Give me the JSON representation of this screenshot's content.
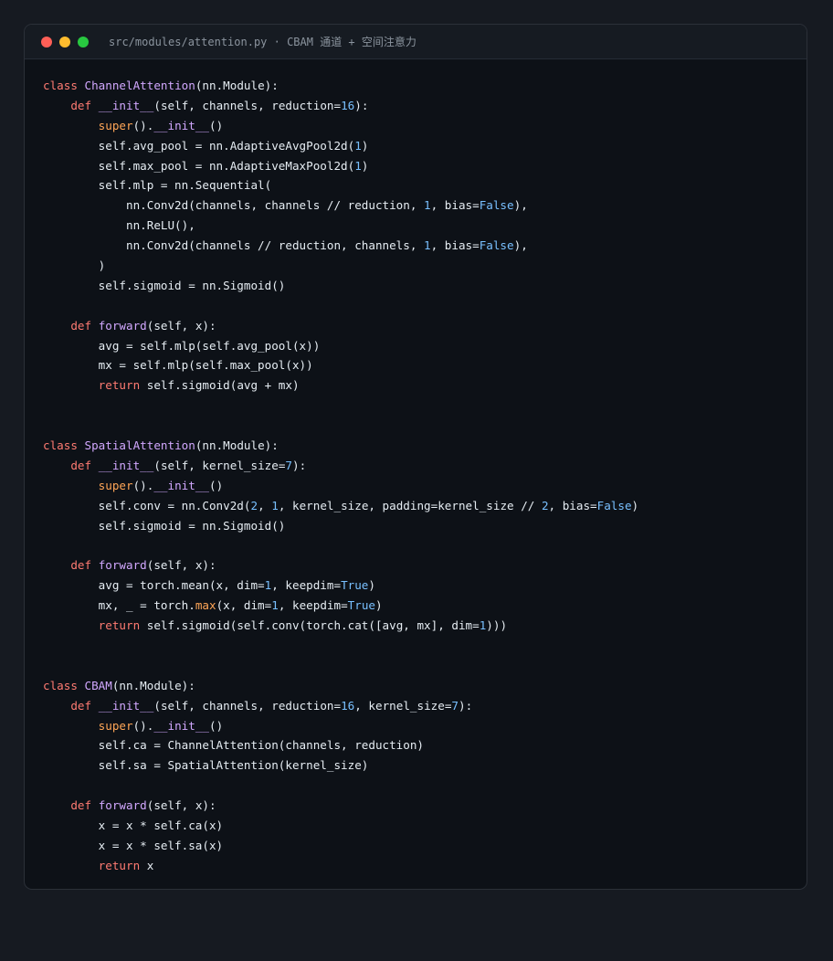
{
  "window": {
    "title": "src/modules/attention.py · CBAM 通道 + 空间注意力"
  },
  "colors": {
    "keyword": "#ff7b72",
    "class_name": "#d2a8ff",
    "function": "#d2a8ff",
    "number": "#79c0ff",
    "builtin": "#ffa657",
    "text": "#e6edf3",
    "background": "#0d1117"
  },
  "code": {
    "language": "python",
    "lines": [
      [
        [
          "kw",
          "class "
        ],
        [
          "cls",
          "ChannelAttention"
        ],
        [
          "plain",
          "(nn.Module):"
        ]
      ],
      [
        [
          "plain",
          "    "
        ],
        [
          "kw",
          "def "
        ],
        [
          "fn",
          "__init__"
        ],
        [
          "plain",
          "(self, channels, reduction="
        ],
        [
          "num",
          "16"
        ],
        [
          "plain",
          "):"
        ]
      ],
      [
        [
          "plain",
          "        "
        ],
        [
          "builtin",
          "super"
        ],
        [
          "plain",
          "()."
        ],
        [
          "fn",
          "__init__"
        ],
        [
          "plain",
          "()"
        ]
      ],
      [
        [
          "plain",
          "        self.avg_pool = nn.AdaptiveAvgPool2d("
        ],
        [
          "num",
          "1"
        ],
        [
          "plain",
          ")"
        ]
      ],
      [
        [
          "plain",
          "        self.max_pool = nn.AdaptiveMaxPool2d("
        ],
        [
          "num",
          "1"
        ],
        [
          "plain",
          ")"
        ]
      ],
      [
        [
          "plain",
          "        self.mlp = nn.Sequential("
        ]
      ],
      [
        [
          "plain",
          "            nn.Conv2d(channels, channels // reduction, "
        ],
        [
          "num",
          "1"
        ],
        [
          "plain",
          ", bias="
        ],
        [
          "const",
          "False"
        ],
        [
          "plain",
          "),"
        ]
      ],
      [
        [
          "plain",
          "            nn.ReLU(),"
        ]
      ],
      [
        [
          "plain",
          "            nn.Conv2d(channels // reduction, channels, "
        ],
        [
          "num",
          "1"
        ],
        [
          "plain",
          ", bias="
        ],
        [
          "const",
          "False"
        ],
        [
          "plain",
          "),"
        ]
      ],
      [
        [
          "plain",
          "        )"
        ]
      ],
      [
        [
          "plain",
          "        self.sigmoid = nn.Sigmoid()"
        ]
      ],
      [],
      [
        [
          "plain",
          "    "
        ],
        [
          "kw",
          "def "
        ],
        [
          "fn",
          "forward"
        ],
        [
          "plain",
          "(self, x):"
        ]
      ],
      [
        [
          "plain",
          "        avg = self.mlp(self.avg_pool(x))"
        ]
      ],
      [
        [
          "plain",
          "        mx = self.mlp(self.max_pool(x))"
        ]
      ],
      [
        [
          "plain",
          "        "
        ],
        [
          "kw",
          "return "
        ],
        [
          "plain",
          "self.sigmoid(avg + mx)"
        ]
      ],
      [],
      [],
      [
        [
          "kw",
          "class "
        ],
        [
          "cls",
          "SpatialAttention"
        ],
        [
          "plain",
          "(nn.Module):"
        ]
      ],
      [
        [
          "plain",
          "    "
        ],
        [
          "kw",
          "def "
        ],
        [
          "fn",
          "__init__"
        ],
        [
          "plain",
          "(self, kernel_size="
        ],
        [
          "num",
          "7"
        ],
        [
          "plain",
          "):"
        ]
      ],
      [
        [
          "plain",
          "        "
        ],
        [
          "builtin",
          "super"
        ],
        [
          "plain",
          "()."
        ],
        [
          "fn",
          "__init__"
        ],
        [
          "plain",
          "()"
        ]
      ],
      [
        [
          "plain",
          "        self.conv = nn.Conv2d("
        ],
        [
          "num",
          "2"
        ],
        [
          "plain",
          ", "
        ],
        [
          "num",
          "1"
        ],
        [
          "plain",
          ", kernel_size, padding=kernel_size // "
        ],
        [
          "num",
          "2"
        ],
        [
          "plain",
          ", bias="
        ],
        [
          "const",
          "False"
        ],
        [
          "plain",
          ")"
        ]
      ],
      [
        [
          "plain",
          "        self.sigmoid = nn.Sigmoid()"
        ]
      ],
      [],
      [
        [
          "plain",
          "    "
        ],
        [
          "kw",
          "def "
        ],
        [
          "fn",
          "forward"
        ],
        [
          "plain",
          "(self, x):"
        ]
      ],
      [
        [
          "plain",
          "        avg = torch.mean(x, dim="
        ],
        [
          "num",
          "1"
        ],
        [
          "plain",
          ", keepdim="
        ],
        [
          "const",
          "True"
        ],
        [
          "plain",
          ")"
        ]
      ],
      [
        [
          "plain",
          "        mx, _ = torch."
        ],
        [
          "builtin",
          "max"
        ],
        [
          "plain",
          "(x, dim="
        ],
        [
          "num",
          "1"
        ],
        [
          "plain",
          ", keepdim="
        ],
        [
          "const",
          "True"
        ],
        [
          "plain",
          ")"
        ]
      ],
      [
        [
          "plain",
          "        "
        ],
        [
          "kw",
          "return "
        ],
        [
          "plain",
          "self.sigmoid(self.conv(torch.cat([avg, mx], dim="
        ],
        [
          "num",
          "1"
        ],
        [
          "plain",
          ")))"
        ]
      ],
      [],
      [],
      [
        [
          "kw",
          "class "
        ],
        [
          "cls",
          "CBAM"
        ],
        [
          "plain",
          "(nn.Module):"
        ]
      ],
      [
        [
          "plain",
          "    "
        ],
        [
          "kw",
          "def "
        ],
        [
          "fn",
          "__init__"
        ],
        [
          "plain",
          "(self, channels, reduction="
        ],
        [
          "num",
          "16"
        ],
        [
          "plain",
          ", kernel_size="
        ],
        [
          "num",
          "7"
        ],
        [
          "plain",
          "):"
        ]
      ],
      [
        [
          "plain",
          "        "
        ],
        [
          "builtin",
          "super"
        ],
        [
          "plain",
          "()."
        ],
        [
          "fn",
          "__init__"
        ],
        [
          "plain",
          "()"
        ]
      ],
      [
        [
          "plain",
          "        self.ca = ChannelAttention(channels, reduction)"
        ]
      ],
      [
        [
          "plain",
          "        self.sa = SpatialAttention(kernel_size)"
        ]
      ],
      [],
      [
        [
          "plain",
          "    "
        ],
        [
          "kw",
          "def "
        ],
        [
          "fn",
          "forward"
        ],
        [
          "plain",
          "(self, x):"
        ]
      ],
      [
        [
          "plain",
          "        x = x * self.ca(x)"
        ]
      ],
      [
        [
          "plain",
          "        x = x * self.sa(x)"
        ]
      ],
      [
        [
          "plain",
          "        "
        ],
        [
          "kw",
          "return "
        ],
        [
          "plain",
          "x"
        ]
      ]
    ]
  }
}
